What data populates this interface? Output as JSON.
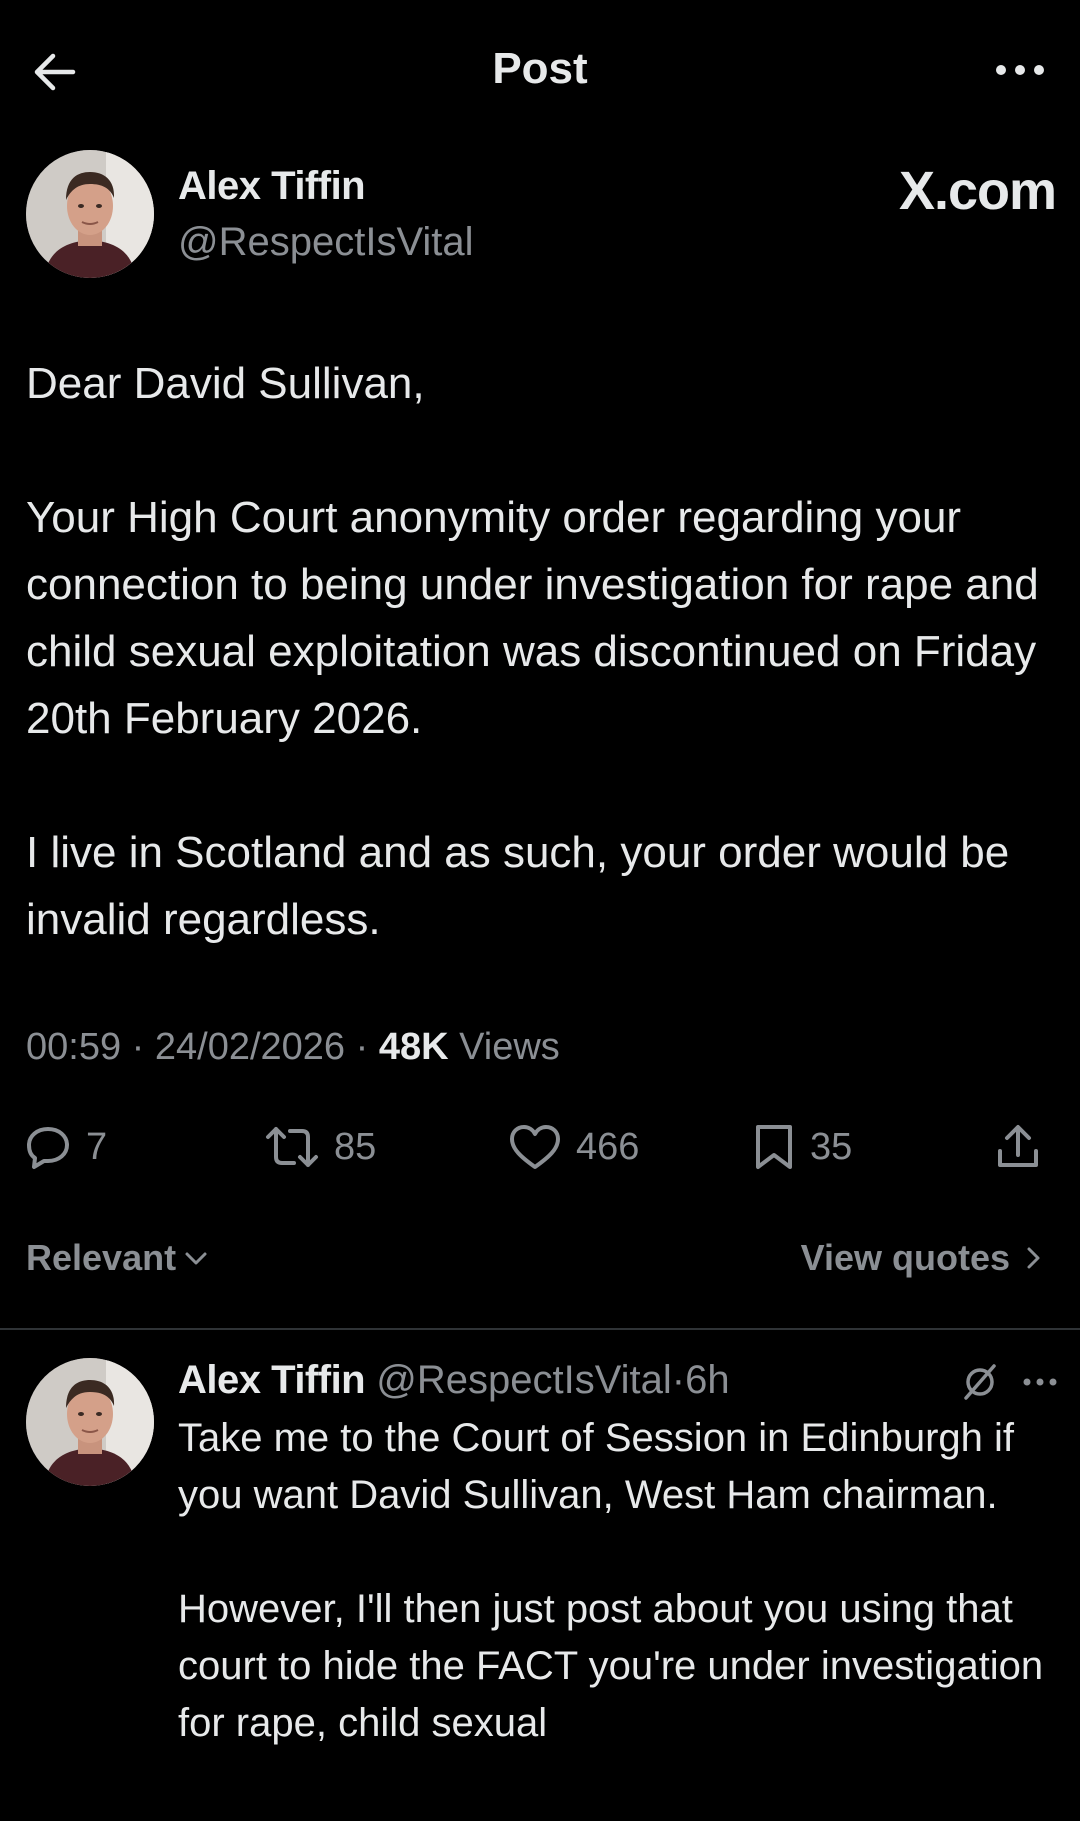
{
  "header": {
    "title": "Post"
  },
  "post": {
    "author_name": "Alex Tiffin",
    "author_handle": "@RespectIsVital",
    "watermark": "X.com",
    "body": "Dear David Sullivan,\n\nYour High Court anonymity order regarding your connection to being under investigation for rape and child sexual exploitation was discontinued on Friday 20th February 2026.\n\nI live in Scotland and as such, your order would be invalid regardless.",
    "time": "00:59",
    "date": "24/02/2026",
    "separator": "·",
    "views_count": "48K",
    "views_label": "Views",
    "replies": "7",
    "reposts": "85",
    "likes": "466",
    "bookmarks": "35"
  },
  "sort": {
    "relevant_label": "Relevant",
    "view_quotes_label": "View quotes"
  },
  "reply": {
    "author_name": "Alex Tiffin",
    "author_handle": "@RespectIsVital",
    "separator": "·",
    "time_ago": "6h",
    "text": "Take me to the Court of Session in Edinburgh if you want David Sullivan, West Ham chairman.\n\nHowever, I'll then just post about you using that court to hide the FACT you're under investigation for rape, child sexual"
  },
  "colors": {
    "background": "#000000",
    "text_primary": "#e7e9ea",
    "text_secondary": "#8b8f94",
    "divider": "#2f3336"
  },
  "icons": [
    "back-arrow-icon",
    "more-icon",
    "reply-icon",
    "repost-icon",
    "like-icon",
    "bookmark-icon",
    "share-icon",
    "chevron-down-icon",
    "chevron-right-icon",
    "grok-icon"
  ]
}
